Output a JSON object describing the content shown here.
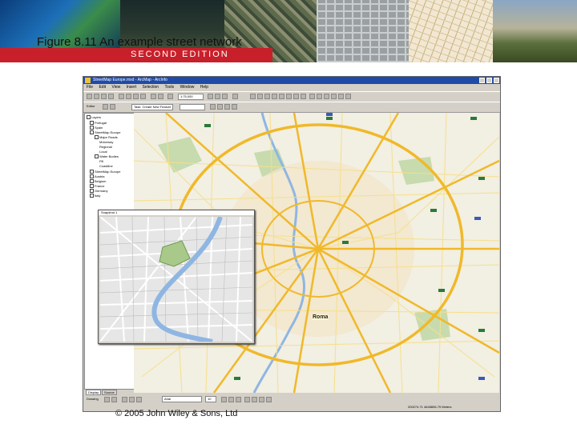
{
  "slide": {
    "title": "Figure 8.11 An example street network",
    "edition": "SECOND EDITION",
    "copyright": "© 2005 John Wiley & Sons, Ltd"
  },
  "app": {
    "window_title": "StreetMap Europe.mxd - ArcMap - ArcInfo",
    "menu": [
      "File",
      "Edit",
      "View",
      "Insert",
      "Selection",
      "Tools",
      "Window",
      "Help"
    ],
    "scale_value": "1:75,000",
    "editor_label": "Editor",
    "task_label": "Task: Create New Feature",
    "toc": {
      "root": "Layers",
      "items": [
        "Portugal",
        "Spain",
        "StreetMap Europe",
        "Major Roads",
        "Motorway",
        "Regional",
        "Local",
        "Water Bodies",
        "Fill",
        "Coastline",
        "StreetMap Europe",
        "Austria",
        "Belgium",
        "France",
        "Germany",
        "Italy"
      ],
      "tabs": [
        "Display",
        "Source"
      ]
    },
    "magnifier_title": "Snapshot 1",
    "map_city_label": "Roma",
    "drawing_label": "Drawing",
    "font_value": "Arial",
    "font_size": "10",
    "status_coords": "200274.71  4645806.79 Meters"
  },
  "colors": {
    "title_bar": "#1f4aa8",
    "chrome": "#d4d0c8",
    "map_bg": "#f2efe3",
    "road_major": "#f0b92a",
    "road_minor": "#f6e08a",
    "park": "#a8c98a",
    "river": "#8fb6e2",
    "banner_red": "#c8202a"
  }
}
